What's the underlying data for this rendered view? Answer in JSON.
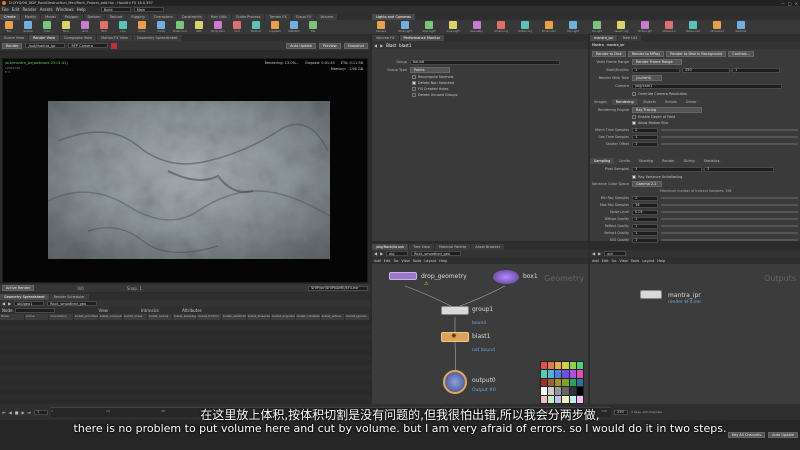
{
  "window": {
    "title": "D:/XYQ/06_DDP_RockDestruction_Mini/Rock_Project_add.hip - Houdini FX 18.0.597"
  },
  "menubar": {
    "items": [
      "File",
      "Edit",
      "Render",
      "Assets",
      "Windows",
      "Help"
    ],
    "build": "Build",
    "desktop": "Main"
  },
  "shelf_tabs": [
    "Create",
    "Modify",
    "Model",
    "Polygon",
    "Deform",
    "Texture",
    "Rigging",
    "Characters",
    "Constraints",
    "Hair Utils",
    "Guide Process",
    "Terrain FX",
    "Cloud FX",
    "Volume",
    "Lights and Cameras"
  ],
  "shelf_tools": [
    "Box",
    "Sphere",
    "Tube",
    "Torus",
    "Grid",
    "Null",
    "Line",
    "Circle",
    "Curve",
    "Draw Curve",
    "Path",
    "Spray Paint",
    "Font",
    "Platonic",
    "L-System",
    "Metaball",
    "File"
  ],
  "light_tools": [
    "Camera",
    "Point Light",
    "Spot Light",
    "Area Light",
    "Geometry Light",
    "Volume Light",
    "Distant Light",
    "Environment",
    "Sky Light",
    "GI Light",
    "Caustic Light",
    "Portal Light",
    "Ambient Light",
    "Stereo Camera",
    "VR Camera",
    "Switcher"
  ],
  "viewer": {
    "tabs": [
      "Scene View",
      "Render View",
      "Composite View",
      "Motion FX View",
      "Geometry Spreadsheet"
    ],
    "renderer": "/out/mantra_ipr",
    "camera": "RFP Camera",
    "render_btn": "Render",
    "auto_update": "Auto Update",
    "preview": "Preview",
    "snapshot": "Snapshot",
    "info_path": "/out/mantra_ipr(wallclock:23:01:41)",
    "rendering": "Rendering: 13.0%...",
    "elapsed": "Elapsed: 0:01:43",
    "eta": "ETA: 0:11:58",
    "memory_label": "Memory:",
    "memory": "1.96 GB",
    "res_line": "1280x720",
    "frame": "fr 1",
    "stats": "0/0",
    "bottom_left": "Active Render",
    "snapshot_count": "Snap. 1",
    "bottom_right": "$HIP/ipr/$HIPNAME/$F4.exr"
  },
  "spreadsheet": {
    "tabs": [
      "Geometry Spreadsheet",
      "Render Scheduler"
    ],
    "path": "obj/geo1",
    "node": "Rock_smoothed_geo",
    "node_label": "Node",
    "view_label": "View",
    "intrinsics": "Intrinsics",
    "attributes": "Attributes",
    "columns": [
      "Node",
      "prime",
      "orientation",
      "bullet_primitive",
      "bullet_computeHull",
      "bullet_mass",
      "bullet_radius",
      "bullet_sleeping",
      "bullet_friction",
      "bullet_restitution",
      "bullet_lineardamping",
      "bullet_angulardamping",
      "bullet_constraint",
      "bullet_active",
      "bullet_ignore"
    ]
  },
  "param_panel": {
    "tabs": [
      "Volume FX",
      "Performance Monitor"
    ],
    "node_type": "Blast",
    "node_name": "blast1",
    "group_label": "Group",
    "group_value": "bound",
    "group_type_label": "Group Type",
    "group_type_value": "Points",
    "checkboxes": [
      "Recompute Normals",
      "Delete Non Selected",
      "Fill Created Holes",
      "Delete Unused Groups"
    ]
  },
  "network_top": {
    "tabs": [
      "/obj/Rock/ibrush",
      "Tree View",
      "Material Palette",
      "Asset Browser"
    ],
    "path": "obj",
    "geo": "Rock_smoothed_geo",
    "menus": [
      "Add",
      "Edit",
      "Go",
      "View",
      "Tools",
      "Layout",
      "Help"
    ],
    "context_label": "Geometry",
    "nodes": {
      "drop_geometry": {
        "name": "drop_geometry"
      },
      "box1": {
        "name": "box1"
      },
      "group1": {
        "name": "group1",
        "sub": "bound"
      },
      "blast1": {
        "name": "blast1",
        "sub": "not bound"
      },
      "output0": {
        "name": "output0",
        "sub": "Output #0"
      }
    }
  },
  "render_params": {
    "tabs": [
      "mantra_ipr",
      "Take List"
    ],
    "node_type": "Mantra",
    "node_name": "mantra_ipr",
    "buttons": [
      "Render to Disk",
      "Render to MPlay",
      "Render to Disk in Background",
      "Controls..."
    ],
    "valid_frame_range_label": "Valid Frame Range",
    "valid_frame_range": "Render Frame Range",
    "start_end_label": "Start/End/Inc",
    "start": "1",
    "end": "250",
    "inc": "1",
    "render_with_take_label": "Render With Take",
    "render_with_take": "(current)",
    "camera_label": "Camera",
    "camera": "/obj/cam1",
    "override_res": "Override Camera Resolution",
    "section_tabs": [
      "Images",
      "Rendering",
      "Objects",
      "Scripts",
      "Driver"
    ],
    "rendering_engine_label": "Rendering Engine",
    "rendering_engine": "Ray Tracing",
    "enable_depth_of_field": "Enable Depth of Field",
    "allow_motion_blur": "Allow Motion Blur",
    "motion_samples_label": "Xform Time Samples",
    "motion_samples": "2",
    "geo_samples_label": "Geo Time Samples",
    "geo_samples": "1",
    "shutter_label": "Shutter Offset",
    "shutter": "1",
    "sub_tabs": [
      "Sampling",
      "Limits",
      "Shading",
      "Render",
      "Dicing",
      "Statistics"
    ],
    "pixel_samples_label": "Pixel Samples",
    "pixel_samples_x": "3",
    "pixel_samples_y": "3",
    "ray_variance_label": "Ray Variance Antialiasing",
    "variance_color_label": "Variance Color Space",
    "variance_color": "Gamma 2.2",
    "max_samples_note": "Maximum number of Indirect Samples: 196",
    "min_ray_label": "Min Ray Samples",
    "min_ray": "2",
    "max_ray_label": "Max Ray Samples",
    "max_ray": "16",
    "noise_level_label": "Noise Level",
    "noise_level": "0.01",
    "diffuse_quality_label": "Diffuse Quality",
    "diffuse_quality": "1",
    "reflect_quality_label": "Reflect Quality",
    "reflect_quality": "1",
    "refract_quality_label": "Refract Quality",
    "refract_quality": "1",
    "sss_quality_label": "SSS Quality",
    "sss_quality": "1"
  },
  "network_out": {
    "path": "out",
    "menus": [
      "Add",
      "Edit",
      "Go",
      "View",
      "Tools",
      "Layout",
      "Help"
    ],
    "context_label": "Outputs",
    "node_name": "mantra_ipr",
    "node_sub": "render $F4.exr"
  },
  "timeline": {
    "frame": "1",
    "ticks": [
      "1",
      "24",
      "48",
      "72",
      "96",
      "120",
      "144",
      "168",
      "192",
      "216",
      "240"
    ],
    "end_frame": "250",
    "right_info": "0 keys, 0/0 channels",
    "key_all": "Key All Channels",
    "auto_update": "Auto Update"
  },
  "subtitles": {
    "zh": "在这里放上体积,按体积切割是没有问题的,但我很怕出错,所以我会分两步做,",
    "en": "there is no problem to put volume here and cut by volume. but I am very afraid of errors. so I would do it in two steps."
  },
  "colors": {
    "accent": "#6fa8dc",
    "node_orange": "#d9a35b",
    "node_purple": "#9b77c9",
    "output_blue": "#5a6fb3"
  }
}
